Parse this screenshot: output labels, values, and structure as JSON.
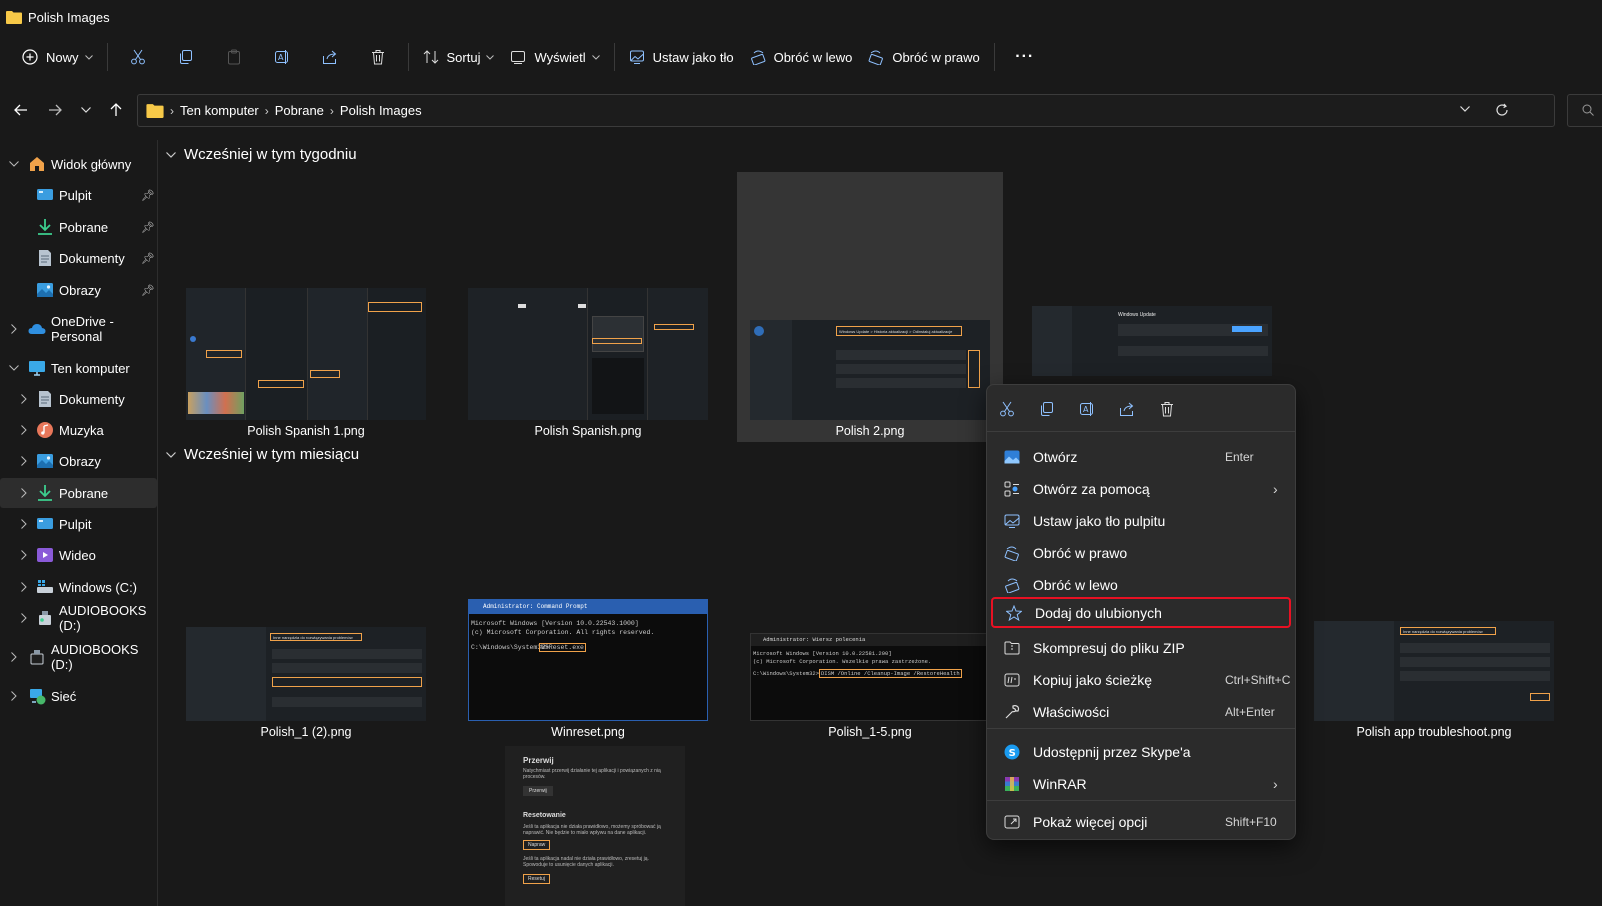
{
  "window": {
    "title": "Polish Images"
  },
  "toolbar": {
    "new_label": "Nowy",
    "sort_label": "Sortuj",
    "view_label": "Wyświetl",
    "set_bg_label": "Ustaw jako tło",
    "rotate_left_label": "Obróć w lewo",
    "rotate_right_label": "Obróć w prawo",
    "more_label": "···"
  },
  "address": {
    "crumbs": [
      "Ten komputer",
      "Pobrane",
      "Polish Images"
    ]
  },
  "sidebar": {
    "home": "Widok główny",
    "quick": [
      "Pulpit",
      "Pobrane",
      "Dokumenty",
      "Obrazy"
    ],
    "onedrive": "OneDrive - Personal",
    "thispc": "Ten komputer",
    "pc_items": [
      "Dokumenty",
      "Muzyka",
      "Obrazy",
      "Pobrane",
      "Pulpit",
      "Wideo",
      "Windows (C:)",
      "AUDIOBOOKS (D:)"
    ],
    "audiobooks": "AUDIOBOOKS (D:)",
    "network": "Sieć"
  },
  "groups": {
    "week": "Wcześniej w tym tygodniu",
    "month": "Wcześniej w tym miesiącu"
  },
  "files": {
    "week": [
      "Polish Spanish 1.png",
      "Polish Spanish.png",
      "Polish 2.png"
    ],
    "month": [
      "Polish_1 (2).png",
      "Winreset.png",
      "Polish_1-5.png",
      "Polish app troubleshoot.png"
    ]
  },
  "thumb_text": {
    "winreset_title": "Administrator: Command Prompt",
    "winreset_l1": "Microsoft Windows [Version 10.0.22543.1000]",
    "winreset_l2": "(c) Microsoft Corporation. All rights reserved.",
    "winreset_prompt": "C:\\Windows\\System32>",
    "winreset_cmd": "WSReset.exe",
    "dism_title": "Administrator: Wiersz polecenia",
    "dism_l1": "Microsoft Windows [Version 10.0.22581.200]",
    "dism_l2": "(c) Microsoft Corporation. Wszelkie prawa zastrzeżone.",
    "dism_prompt": "C:\\Windows\\System32>",
    "dism_cmd": "DISM /Online /Cleanup-Image /RestoreHealth",
    "wu_title": "Windows Update",
    "p2_path": "Windows Update > Historia aktualizacji > Odinstaluj aktualizacje",
    "trouble_title": "Inne narzędzia do rozwiązywania problemów",
    "przerwij": "Przerwij",
    "przerwij_desc": "Natychmiast przerwij działanie tej aplikacji i powiązanych z nią procesów.",
    "przerwij_btn": "Przerwij",
    "reset_head": "Resetowanie",
    "reset_desc1": "Jeśli ta aplikacja nie działa prawidłowo, możemy spróbować ją naprawić. Nie będzie to miało wpływu na dane aplikacji.",
    "napraw_btn": "Napraw",
    "reset_desc2": "Jeśli ta aplikacja nadal nie działa prawidłowo, zresetuj ją. Spowoduje to usunięcie danych aplikacji.",
    "resetuj_btn": "Resetuj"
  },
  "context_menu": {
    "items": [
      {
        "label": "Otwórz",
        "key": "Enter"
      },
      {
        "label": "Otwórz za pomocą",
        "key": ""
      },
      {
        "label": "Ustaw jako tło pulpitu",
        "key": ""
      },
      {
        "label": "Obróć w prawo",
        "key": ""
      },
      {
        "label": "Obróć w lewo",
        "key": ""
      },
      {
        "label": "Dodaj do ulubionych",
        "key": ""
      },
      {
        "label": "Skompresuj do pliku ZIP",
        "key": ""
      },
      {
        "label": "Kopiuj jako ścieżkę",
        "key": "Ctrl+Shift+C"
      },
      {
        "label": "Właściwości",
        "key": "Alt+Enter"
      },
      {
        "label": "Udostępnij przez Skype'a",
        "key": ""
      },
      {
        "label": "WinRAR",
        "key": ""
      },
      {
        "label": "Pokaż więcej opcji",
        "key": "Shift+F10"
      }
    ]
  },
  "colors": {
    "accent": "#e81123",
    "folder": "#f7c948",
    "blue": "#4aa3ff",
    "bg": "#191919"
  }
}
